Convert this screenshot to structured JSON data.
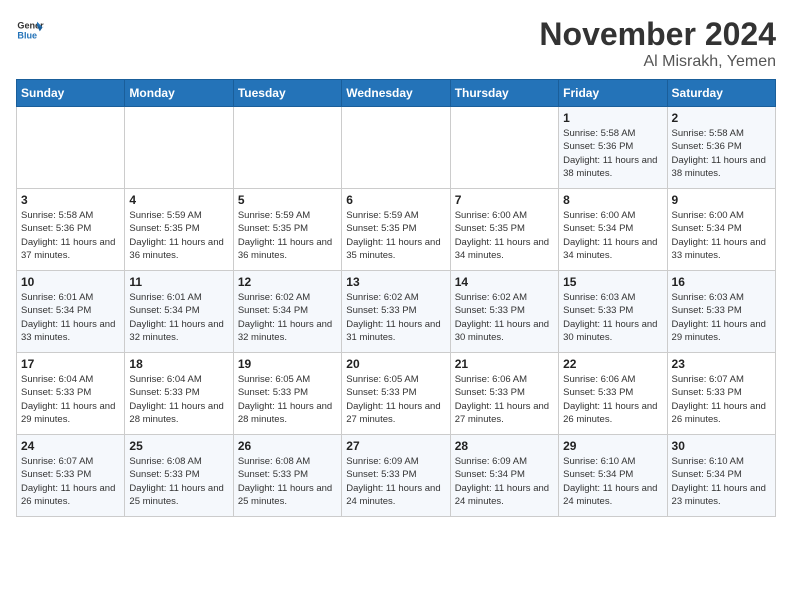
{
  "header": {
    "logo_line1": "General",
    "logo_line2": "Blue",
    "month_year": "November 2024",
    "location": "Al Misrakh, Yemen"
  },
  "weekdays": [
    "Sunday",
    "Monday",
    "Tuesday",
    "Wednesday",
    "Thursday",
    "Friday",
    "Saturday"
  ],
  "weeks": [
    [
      {
        "day": "",
        "info": ""
      },
      {
        "day": "",
        "info": ""
      },
      {
        "day": "",
        "info": ""
      },
      {
        "day": "",
        "info": ""
      },
      {
        "day": "",
        "info": ""
      },
      {
        "day": "1",
        "info": "Sunrise: 5:58 AM\nSunset: 5:36 PM\nDaylight: 11 hours and 38 minutes."
      },
      {
        "day": "2",
        "info": "Sunrise: 5:58 AM\nSunset: 5:36 PM\nDaylight: 11 hours and 38 minutes."
      }
    ],
    [
      {
        "day": "3",
        "info": "Sunrise: 5:58 AM\nSunset: 5:36 PM\nDaylight: 11 hours and 37 minutes."
      },
      {
        "day": "4",
        "info": "Sunrise: 5:59 AM\nSunset: 5:35 PM\nDaylight: 11 hours and 36 minutes."
      },
      {
        "day": "5",
        "info": "Sunrise: 5:59 AM\nSunset: 5:35 PM\nDaylight: 11 hours and 36 minutes."
      },
      {
        "day": "6",
        "info": "Sunrise: 5:59 AM\nSunset: 5:35 PM\nDaylight: 11 hours and 35 minutes."
      },
      {
        "day": "7",
        "info": "Sunrise: 6:00 AM\nSunset: 5:35 PM\nDaylight: 11 hours and 34 minutes."
      },
      {
        "day": "8",
        "info": "Sunrise: 6:00 AM\nSunset: 5:34 PM\nDaylight: 11 hours and 34 minutes."
      },
      {
        "day": "9",
        "info": "Sunrise: 6:00 AM\nSunset: 5:34 PM\nDaylight: 11 hours and 33 minutes."
      }
    ],
    [
      {
        "day": "10",
        "info": "Sunrise: 6:01 AM\nSunset: 5:34 PM\nDaylight: 11 hours and 33 minutes."
      },
      {
        "day": "11",
        "info": "Sunrise: 6:01 AM\nSunset: 5:34 PM\nDaylight: 11 hours and 32 minutes."
      },
      {
        "day": "12",
        "info": "Sunrise: 6:02 AM\nSunset: 5:34 PM\nDaylight: 11 hours and 32 minutes."
      },
      {
        "day": "13",
        "info": "Sunrise: 6:02 AM\nSunset: 5:33 PM\nDaylight: 11 hours and 31 minutes."
      },
      {
        "day": "14",
        "info": "Sunrise: 6:02 AM\nSunset: 5:33 PM\nDaylight: 11 hours and 30 minutes."
      },
      {
        "day": "15",
        "info": "Sunrise: 6:03 AM\nSunset: 5:33 PM\nDaylight: 11 hours and 30 minutes."
      },
      {
        "day": "16",
        "info": "Sunrise: 6:03 AM\nSunset: 5:33 PM\nDaylight: 11 hours and 29 minutes."
      }
    ],
    [
      {
        "day": "17",
        "info": "Sunrise: 6:04 AM\nSunset: 5:33 PM\nDaylight: 11 hours and 29 minutes."
      },
      {
        "day": "18",
        "info": "Sunrise: 6:04 AM\nSunset: 5:33 PM\nDaylight: 11 hours and 28 minutes."
      },
      {
        "day": "19",
        "info": "Sunrise: 6:05 AM\nSunset: 5:33 PM\nDaylight: 11 hours and 28 minutes."
      },
      {
        "day": "20",
        "info": "Sunrise: 6:05 AM\nSunset: 5:33 PM\nDaylight: 11 hours and 27 minutes."
      },
      {
        "day": "21",
        "info": "Sunrise: 6:06 AM\nSunset: 5:33 PM\nDaylight: 11 hours and 27 minutes."
      },
      {
        "day": "22",
        "info": "Sunrise: 6:06 AM\nSunset: 5:33 PM\nDaylight: 11 hours and 26 minutes."
      },
      {
        "day": "23",
        "info": "Sunrise: 6:07 AM\nSunset: 5:33 PM\nDaylight: 11 hours and 26 minutes."
      }
    ],
    [
      {
        "day": "24",
        "info": "Sunrise: 6:07 AM\nSunset: 5:33 PM\nDaylight: 11 hours and 26 minutes."
      },
      {
        "day": "25",
        "info": "Sunrise: 6:08 AM\nSunset: 5:33 PM\nDaylight: 11 hours and 25 minutes."
      },
      {
        "day": "26",
        "info": "Sunrise: 6:08 AM\nSunset: 5:33 PM\nDaylight: 11 hours and 25 minutes."
      },
      {
        "day": "27",
        "info": "Sunrise: 6:09 AM\nSunset: 5:33 PM\nDaylight: 11 hours and 24 minutes."
      },
      {
        "day": "28",
        "info": "Sunrise: 6:09 AM\nSunset: 5:34 PM\nDaylight: 11 hours and 24 minutes."
      },
      {
        "day": "29",
        "info": "Sunrise: 6:10 AM\nSunset: 5:34 PM\nDaylight: 11 hours and 24 minutes."
      },
      {
        "day": "30",
        "info": "Sunrise: 6:10 AM\nSunset: 5:34 PM\nDaylight: 11 hours and 23 minutes."
      }
    ]
  ]
}
